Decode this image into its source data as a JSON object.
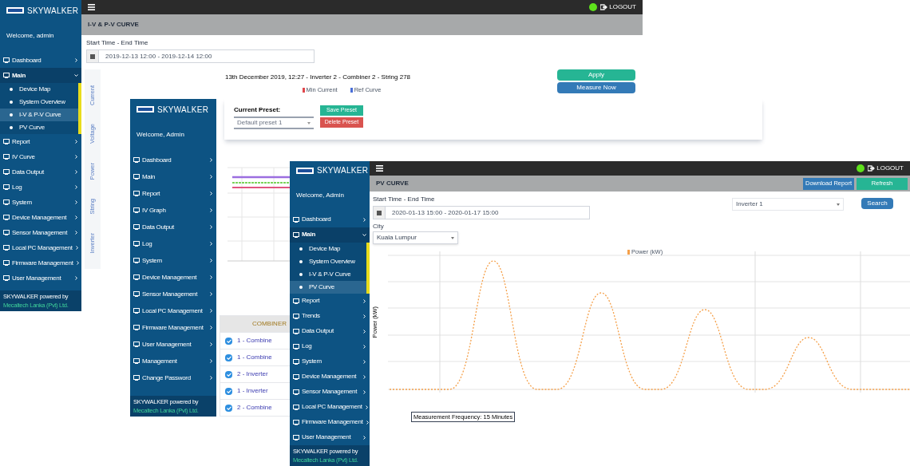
{
  "back_window": {
    "brand": "SKYWALKER",
    "welcome": "Welcome, admin",
    "logout": "LOGOUT",
    "header": "I-V & P-V CURVE",
    "menu": [
      {
        "label": "Dashboard",
        "selected": false
      },
      {
        "label": "Main",
        "selected": true,
        "expanded": true,
        "children": [
          {
            "label": "Device Map",
            "selected": false
          },
          {
            "label": "System Overview",
            "selected": false
          },
          {
            "label": "I-V & P-V Curve",
            "selected": true
          },
          {
            "label": "PV Curve",
            "selected": false
          }
        ]
      },
      {
        "label": "Report",
        "selected": false
      },
      {
        "label": "IV Curve",
        "selected": false
      },
      {
        "label": "Data Output",
        "selected": false
      },
      {
        "label": "Log",
        "selected": false
      },
      {
        "label": "System",
        "selected": false
      },
      {
        "label": "Device Management",
        "selected": false
      },
      {
        "label": "Sensor Management",
        "selected": false
      },
      {
        "label": "Local PC Management",
        "selected": false
      },
      {
        "label": "Firmware Management",
        "selected": false
      },
      {
        "label": "User Management",
        "selected": false
      }
    ],
    "footer": [
      "SKYWALKER powered by",
      "Mecaltech Lanka (Pvt) Ltd."
    ],
    "time_label": "Start Time - End Time",
    "time_value": "2019-12-13 12:00 - 2019-12-14 12:00",
    "side_tabs": [
      {
        "label": "Current",
        "selected": false
      },
      {
        "label": "Voltage",
        "selected": false
      },
      {
        "label": "Power",
        "selected": false
      },
      {
        "label": "String",
        "selected": false
      },
      {
        "label": "Inverter",
        "selected": false
      }
    ],
    "chart_title": "13th December 2019, 12:27 - Inverter 2 - Combiner 2 - String 278",
    "legend": [
      {
        "label": "Min Current",
        "color": "#e0474c"
      },
      {
        "label": "Ref Curve",
        "color": "#4a6fd8"
      }
    ],
    "buttons": [
      {
        "label": "Apply",
        "kind": "success"
      },
      {
        "label": "Measure Now",
        "kind": "primary"
      }
    ]
  },
  "middle_window": {
    "brand": "SKYWALKER",
    "welcome": "Welcome, Admin",
    "menu": [
      {
        "label": "Dashboard",
        "selected": false
      },
      {
        "label": "Main",
        "selected": false
      },
      {
        "label": "Report",
        "selected": false
      },
      {
        "label": "IV Graph",
        "selected": false
      },
      {
        "label": "Data Output",
        "selected": false
      },
      {
        "label": "Log",
        "selected": false
      },
      {
        "label": "System",
        "selected": false
      },
      {
        "label": "Device Management",
        "selected": false
      },
      {
        "label": "Sensor Management",
        "selected": false
      },
      {
        "label": "Local PC Management",
        "selected": false
      },
      {
        "label": "Firmware Management",
        "selected": false
      },
      {
        "label": "User Management",
        "selected": false
      },
      {
        "label": "Management",
        "selected": false
      },
      {
        "label": "Change Password",
        "selected": false
      }
    ],
    "footer": [
      "SKYWALKER powered by",
      "Mecaltech Lanka (Pvt) Ltd."
    ],
    "preset_label": "Current Preset:",
    "preset_value": "Default preset 1",
    "preset_buttons": [
      {
        "label": "Save Preset",
        "kind": "success"
      },
      {
        "label": "Delete Preset",
        "kind": "danger"
      }
    ],
    "table_header": "COMBINER",
    "rows": [
      {
        "label": "1 - Combine",
        "checked": true
      },
      {
        "label": "1 - Combine",
        "checked": true
      },
      {
        "label": "2 - Inverter",
        "checked": true
      },
      {
        "label": "1 - Inverter",
        "checked": true
      },
      {
        "label": "2 - Combine",
        "checked": true
      }
    ]
  },
  "front_window": {
    "brand": "SKYWALKER",
    "welcome": "Welcome, Admin",
    "logout": "LOGOUT",
    "header": "PV CURVE",
    "header_buttons": [
      {
        "label": "Download Report",
        "kind": "primary"
      },
      {
        "label": "Refresh",
        "kind": "success"
      }
    ],
    "menu": [
      {
        "label": "Dashboard",
        "selected": false
      },
      {
        "label": "Main",
        "selected": true,
        "expanded": true,
        "children": [
          {
            "label": "Device Map",
            "selected": false
          },
          {
            "label": "System Overview",
            "selected": false
          },
          {
            "label": "I-V & P-V Curve",
            "selected": false
          },
          {
            "label": "PV Curve",
            "selected": true
          }
        ]
      },
      {
        "label": "Report",
        "selected": false
      },
      {
        "label": "Trends",
        "selected": false
      },
      {
        "label": "Data Output",
        "selected": false
      },
      {
        "label": "Log",
        "selected": false
      },
      {
        "label": "System",
        "selected": false
      },
      {
        "label": "Device Management",
        "selected": false
      },
      {
        "label": "Sensor Management",
        "selected": false
      },
      {
        "label": "Local PC Management",
        "selected": false
      },
      {
        "label": "Firmware Management",
        "selected": false
      },
      {
        "label": "User Management",
        "selected": false
      }
    ],
    "footer": [
      "SKYWALKER powered by",
      "Mecaltech Lanka (Pvt) Ltd."
    ],
    "time_label": "Start Time - End Time",
    "time_value": "2020-01-13 15:00 - 2020-01-17 15:00",
    "inverter_value": "Inverter 1",
    "search_button": "Search",
    "city_label": "City",
    "city_value": "Kuala Lumpur",
    "legend": "Power (kW)",
    "axis_title": "Power (kW)",
    "frequency_note": "Measurement Frequency: 15 Minutes"
  }
}
